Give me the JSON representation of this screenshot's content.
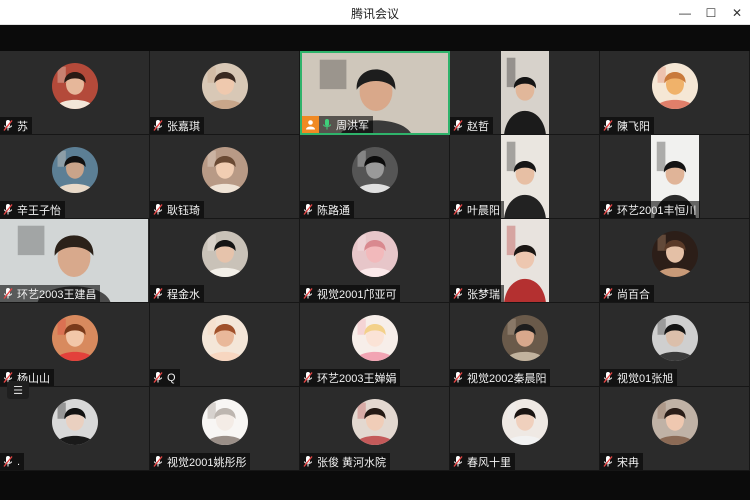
{
  "window": {
    "title": "腾讯会议"
  },
  "participants": [
    {
      "name": "苏",
      "kind": "avatar",
      "skin": "#e6b79a",
      "hair": "#2a1a14",
      "bg": "#b44a3a",
      "accent": "#f2e6d8"
    },
    {
      "name": "张嘉琪",
      "kind": "avatar",
      "skin": "#efc9ae",
      "hair": "#3a2a22",
      "bg": "#d8c8b6",
      "accent": "#c8a68a"
    },
    {
      "name": "周洪军",
      "kind": "video-wide",
      "host": true,
      "skin": "#d9a88a",
      "hair": "#1d1d1d",
      "bg": "#cfc7bb",
      "accent": "#3a3a3a"
    },
    {
      "name": "赵哲",
      "kind": "video-center",
      "skin": "#e1b79a",
      "hair": "#151515",
      "bg": "#d7d2cb",
      "accent": "#1b1b1b"
    },
    {
      "name": "陳飞阳",
      "kind": "avatar",
      "skin": "#f0b26a",
      "hair": "#c97a3c",
      "bg": "#f5e7d5",
      "accent": "#e07f6a"
    },
    {
      "name": "辛王子怡",
      "kind": "avatar",
      "skin": "#c9a48a",
      "hair": "#111111",
      "bg": "#5c7f95",
      "accent": "#e8d9c8"
    },
    {
      "name": "耿钰琦",
      "kind": "avatar",
      "skin": "#f1cdb2",
      "hair": "#6a4a34",
      "bg": "#b89a86",
      "accent": "#efe3d6"
    },
    {
      "name": "陈路通",
      "kind": "avatar",
      "skin": "#9a9a9a",
      "hair": "#0c0c0c",
      "bg": "#555555",
      "accent": "#e0e0e0"
    },
    {
      "name": "叶晨阳",
      "kind": "video-center",
      "skin": "#e7bfa4",
      "hair": "#161616",
      "bg": "#eae6e0",
      "accent": "#222222"
    },
    {
      "name": "环艺2001丰恒川",
      "kind": "video-center",
      "skin": "#e0b498",
      "hair": "#141414",
      "bg": "#f1f1ef",
      "accent": "#2a2a2a"
    },
    {
      "name": "环艺2003王建昌",
      "kind": "video-wide",
      "skin": "#d8a98c",
      "hair": "#2b2119",
      "bg": "#d2d6d6",
      "accent": "#4b4b4b"
    },
    {
      "name": "程金水",
      "kind": "avatar",
      "skin": "#e6c3ab",
      "hair": "#151515",
      "bg": "#c9c2b8",
      "accent": "#f3efe8"
    },
    {
      "name": "视觉2001邝亚可",
      "kind": "avatar",
      "skin": "#f2b9bb",
      "hair": "#d9898f",
      "bg": "#e7c6c9",
      "accent": "#fbe9ea"
    },
    {
      "name": "张梦瑞",
      "kind": "video-center",
      "skin": "#edc7b0",
      "hair": "#1b1714",
      "bg": "#e8e3de",
      "accent": "#b43030"
    },
    {
      "name": "尚百合",
      "kind": "avatar",
      "skin": "#e4c0a6",
      "hair": "#5a3a28",
      "bg": "#2c1e18",
      "accent": "#c89a78"
    },
    {
      "name": "杨山山",
      "kind": "avatar",
      "skin": "#f2c7a9",
      "hair": "#7a3a1a",
      "bg": "#d88a5e",
      "accent": "#e3413b"
    },
    {
      "name": "Q",
      "kind": "avatar",
      "skin": "#e9b89a",
      "hair": "#a0502a",
      "bg": "#f4e6d8",
      "accent": "#f7d6c0"
    },
    {
      "name": "环艺2003王婵娟",
      "kind": "avatar",
      "skin": "#fbe3d6",
      "hair": "#f3d18a",
      "bg": "#f7eee9",
      "accent": "#f2a4b3"
    },
    {
      "name": "视觉2002秦晨阳",
      "kind": "avatar",
      "skin": "#d8a88c",
      "hair": "#1d1d1d",
      "bg": "#6a5a4a",
      "accent": "#c2b39e"
    },
    {
      "name": "视觉01张旭",
      "kind": "avatar",
      "skin": "#dbbfab",
      "hair": "#141414",
      "bg": "#cfcfcf",
      "accent": "#3a3a3a"
    },
    {
      "name": ".",
      "kind": "avatar",
      "skin": "#ead0c0",
      "hair": "#121212",
      "bg": "#d9d9d9",
      "accent": "#1a1a1a"
    },
    {
      "name": "视觉2001姚彤彤",
      "kind": "avatar",
      "skin": "#f4ece6",
      "hair": "#bdb6b0",
      "bg": "#f8f6f4",
      "accent": "#9a8f88"
    },
    {
      "name": "张俊 黄河水院",
      "kind": "avatar",
      "skin": "#f0cdb8",
      "hair": "#241914",
      "bg": "#e3d8d0",
      "accent": "#c45a5a"
    },
    {
      "name": "春风十里",
      "kind": "avatar",
      "skin": "#f0d0bd",
      "hair": "#1a1412",
      "bg": "#efe9e4",
      "accent": "#f2f2f2"
    },
    {
      "name": "宋冉",
      "kind": "avatar",
      "skin": "#efc8b0",
      "hair": "#2a1d18",
      "bg": "#c0b2a6",
      "accent": "#8b6a55"
    }
  ],
  "list_button_label": "☰"
}
